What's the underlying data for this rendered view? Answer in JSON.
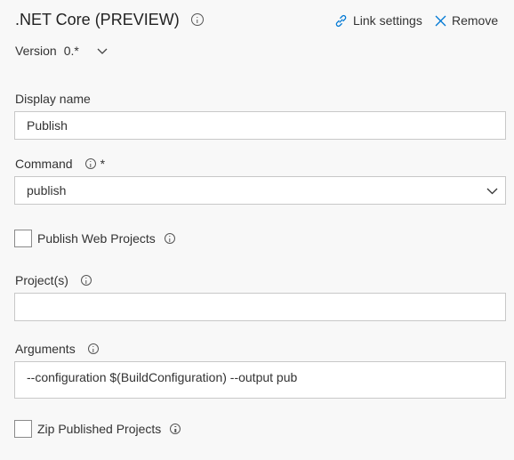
{
  "header": {
    "title": ".NET Core (PREVIEW)",
    "link_settings_label": "Link settings",
    "remove_label": "Remove"
  },
  "version": {
    "label": "Version",
    "value": "0.*"
  },
  "fields": {
    "display_name": {
      "label": "Display name",
      "value": "Publish"
    },
    "command": {
      "label": "Command",
      "required_marker": "*",
      "value": "publish"
    },
    "publish_web_projects": {
      "label": "Publish Web Projects",
      "checked": false
    },
    "projects": {
      "label": "Project(s)",
      "value": ""
    },
    "arguments": {
      "label": "Arguments",
      "value": "--configuration $(BuildConfiguration) --output pub"
    },
    "zip_published_projects": {
      "label": "Zip Published Projects",
      "checked": false
    }
  },
  "colors": {
    "background": "#f8f8f8",
    "link_accent": "#0078d4",
    "border": "#c8c8c8"
  }
}
